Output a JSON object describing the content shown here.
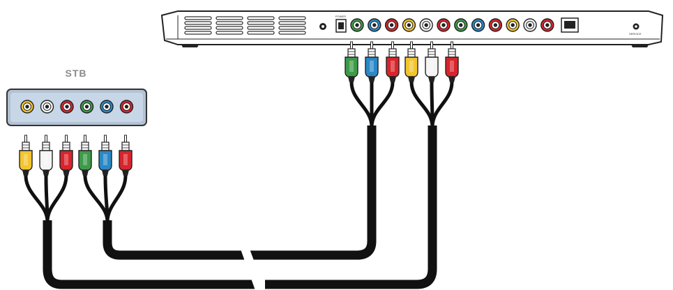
{
  "stb_label": "STB",
  "device_labels": {
    "power": "POWER",
    "service": "SERVICE"
  },
  "colors": {
    "green": "#3e9a4a",
    "blue": "#2a88c6",
    "red": "#d8242c",
    "yellow": "#f2c530",
    "white": "#f4f4f4",
    "cable": "#111111",
    "stb_body": "#c7d7e8"
  },
  "stb_ports": [
    "yellow",
    "white",
    "red",
    "green",
    "blue",
    "red"
  ],
  "device_ports": [
    "green",
    "blue",
    "red",
    "yellow",
    "white",
    "red",
    "green",
    "blue",
    "red",
    "yellow",
    "white",
    "red"
  ],
  "stb_plugs": [
    "yellow",
    "white",
    "red",
    "green",
    "blue",
    "red"
  ],
  "device_plugs": [
    "green",
    "blue",
    "red",
    "yellow",
    "white",
    "red"
  ]
}
